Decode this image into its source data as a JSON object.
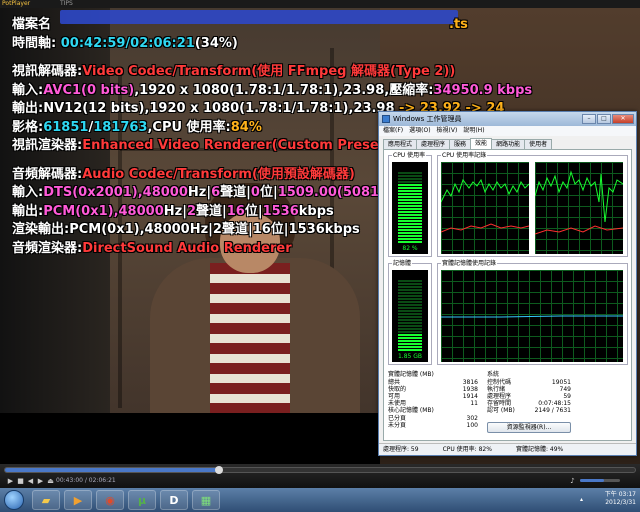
{
  "player": {
    "app_name": "PotPlayer",
    "tab_label": "TIPS",
    "osd": {
      "file_label": "檔案名",
      "file_ext": ".ts",
      "timeline_label": "時間軸:",
      "timeline_value": "00:42:59/02:06:21",
      "timeline_pct": "(34%)",
      "vdecoder_label": "視訊解碼器:",
      "vdecoder_value": "Video Codec/Transform(使用 FFmpeg 解碼器(Type 2))",
      "vin_label": "輸入:",
      "vin_codec": "AVC1(0 bits)",
      "vin_rest": ",1920 x 1080(1.78:1/1.78:1),23.98,",
      "vin_ratio_label": "壓縮率:",
      "vin_ratio": "34950.9 kbps",
      "vout_label": "輸出:",
      "vout_value": "NV12(12 bits),1920 x 1080(1.78:1/1.78:1),23.98",
      "vout_fps": " -> 23.92 -> 24",
      "frames_label": "影格:",
      "frames_a": "61851",
      "frames_b": "181763",
      "cpu_label": ",CPU 使用率:",
      "cpu_value": "84%",
      "vrenderer_label": "視訊渲染器:",
      "vrenderer_value": "Enhanced Video Renderer(Custom Presenter)",
      "adecoder_label": "音頻解碼器:",
      "adecoder_value": "Audio Codec/Transform(使用預設解碼器)",
      "ain_label": "輸入:",
      "ain_codec": "DTS(0x2001)",
      "ain_hz": ",48000",
      "ain_hz_unit": "Hz|",
      "ain_ch": "6",
      "ain_ch_unit": "聲道|",
      "ain_bits": "0",
      "ain_bits_unit": "位|",
      "ain_rate": "1509.00(5081)",
      "ain_rate_unit": "kbps",
      "aout_label": "輸出:",
      "aout_codec": "PCM(0x1)",
      "aout_hz": ",48000",
      "aout_hz_unit": "Hz|",
      "aout_ch": "2",
      "aout_ch_unit": "聲道|",
      "aout_bits": "16",
      "aout_bits_unit": "位|",
      "aout_rate": "1536",
      "aout_rate_unit": "kbps",
      "rout_label": "渲染輸出:",
      "rout_value": "PCM(0x1),48000Hz|2聲道|16位|1536kbps",
      "arenderer_label": "音頻渲染器:",
      "arenderer_value": "DirectSound Audio Renderer"
    },
    "controls": {
      "time_display": "00:43:00 / 02:06:21",
      "progress_fraction": 0.34,
      "volume_fraction": 0.6
    }
  },
  "task_manager": {
    "title": "Windows 工作管理員",
    "menu": [
      "檔案(F)",
      "選項(O)",
      "檢視(V)",
      "說明(H)"
    ],
    "tabs": [
      "應用程式",
      "處理程序",
      "服務",
      "效能",
      "網路功能",
      "使用者"
    ],
    "active_tab": 3,
    "cpu_usage_label": "CPU 使用率",
    "cpu_usage_value": "82 %",
    "cpu_usage_fraction": 0.82,
    "cpu_history_label": "CPU 使用率記錄",
    "mem_label": "記憶體",
    "mem_value": "1.85 GB",
    "mem_fraction": 0.25,
    "mem_history_label": "實體記憶體使用記錄",
    "physical_mem": {
      "heading": "實體記憶體 (MB)",
      "rows": [
        {
          "label": "總共",
          "value": "3816"
        },
        {
          "label": "快取的",
          "value": "1938"
        },
        {
          "label": "可用",
          "value": "1914"
        },
        {
          "label": "未使用",
          "value": "11"
        }
      ]
    },
    "kernel_mem": {
      "heading": "核心記憶體 (MB)",
      "rows": [
        {
          "label": "已分頁",
          "value": "302"
        },
        {
          "label": "未分頁",
          "value": "100"
        }
      ]
    },
    "system": {
      "heading": "系統",
      "rows": [
        {
          "label": "控制代碼",
          "value": "19051"
        },
        {
          "label": "執行緒",
          "value": "749"
        },
        {
          "label": "處理程序",
          "value": "59"
        },
        {
          "label": "存留時間",
          "value": "0:07:48:15"
        },
        {
          "label": "認可 (MB)",
          "value": "2149 / 7631"
        }
      ]
    },
    "resource_monitor_button": "資源監視器(R)...",
    "status": {
      "processes": "處理程序: 59",
      "cpu": "CPU 使用率: 82%",
      "memory": "實體記憶體: 49%"
    }
  },
  "taskbar": {
    "clock_time": "下午 03:17",
    "clock_date": "2012/3/31"
  },
  "colors": {
    "osd_white": "#ffffff",
    "osd_cyan": "#2fd8f2",
    "osd_magenta": "#ff5ad8",
    "osd_red": "#ff3a3a",
    "osd_orange": "#ffb21a",
    "graph_green": "#18ff30"
  }
}
